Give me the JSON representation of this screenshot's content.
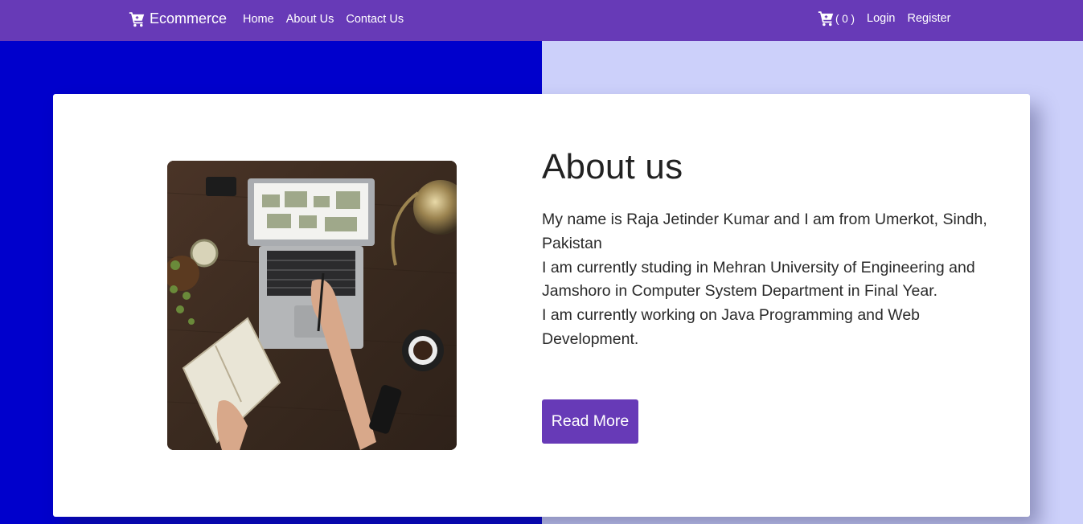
{
  "navbar": {
    "brand": "Ecommerce",
    "links": [
      "Home",
      "About Us",
      "Contact Us"
    ],
    "cart_count": "( 0 )",
    "login": "Login",
    "register": "Register"
  },
  "about": {
    "title": "About us",
    "paragraphs": [
      "My name is Raja Jetinder Kumar and I am from Umerkot, Sindh, Pakistan",
      "I am currently studing in Mehran University of Engineering and Jamshoro in Computer System Department in Final Year.",
      "I am currently working on Java Programming and Web Development."
    ],
    "read_more": "Read More"
  },
  "colors": {
    "navbar": "#673ab7",
    "bg_left": "#0000cc",
    "bg_right": "#ccd0fa",
    "button": "#673ab7"
  }
}
